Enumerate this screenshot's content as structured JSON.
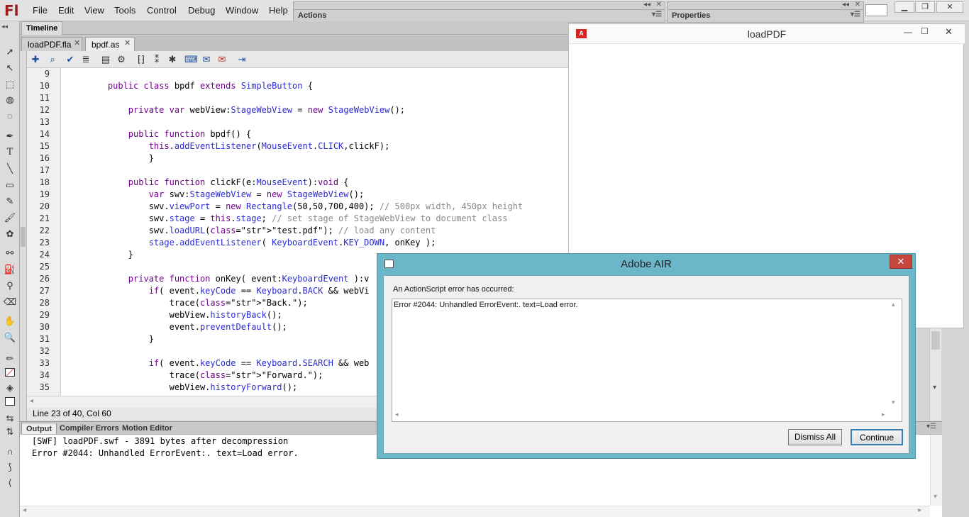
{
  "menubar": {
    "logo": "Fl",
    "items": [
      "File",
      "Edit",
      "View",
      "Tools",
      "Control",
      "Debug",
      "Window",
      "Help"
    ]
  },
  "panels": {
    "actions_label": "Actions",
    "properties_label": "Properties",
    "timeline_label": "Timeline"
  },
  "doc_tabs": [
    "loadPDF.fla",
    "bpdf.as"
  ],
  "code": {
    "lines": [
      {
        "n": "9",
        "text": ""
      },
      {
        "n": "10",
        "text": "    public class bpdf extends SimpleButton {"
      },
      {
        "n": "11",
        "text": ""
      },
      {
        "n": "12",
        "text": "        private var webView:StageWebView = new StageWebView();"
      },
      {
        "n": "13",
        "text": ""
      },
      {
        "n": "14",
        "text": "        public function bpdf() {"
      },
      {
        "n": "15",
        "text": "            this.addEventListener(MouseEvent.CLICK,clickF);"
      },
      {
        "n": "16",
        "text": "            }"
      },
      {
        "n": "17",
        "text": ""
      },
      {
        "n": "18",
        "text": "        public function clickF(e:MouseEvent):void {"
      },
      {
        "n": "19",
        "text": "            var swv:StageWebView = new StageWebView();"
      },
      {
        "n": "20",
        "text": "            swv.viewPort = new Rectangle(50,50,700,400); // 500px width, 450px height"
      },
      {
        "n": "21",
        "text": "            swv.stage = this.stage; // set stage of StageWebView to document class"
      },
      {
        "n": "22",
        "text": "            swv.loadURL(\"test.pdf\"); // load any content"
      },
      {
        "n": "23",
        "text": "            stage.addEventListener( KeyboardEvent.KEY_DOWN, onKey );"
      },
      {
        "n": "24",
        "text": "        }"
      },
      {
        "n": "25",
        "text": ""
      },
      {
        "n": "26",
        "text": "        private function onKey( event:KeyboardEvent ):v"
      },
      {
        "n": "27",
        "text": "            if( event.keyCode == Keyboard.BACK && webVi"
      },
      {
        "n": "28",
        "text": "                trace(\"Back.\");"
      },
      {
        "n": "29",
        "text": "                webView.historyBack();"
      },
      {
        "n": "30",
        "text": "                event.preventDefault();"
      },
      {
        "n": "31",
        "text": "            }"
      },
      {
        "n": "32",
        "text": ""
      },
      {
        "n": "33",
        "text": "            if( event.keyCode == Keyboard.SEARCH && web"
      },
      {
        "n": "34",
        "text": "                trace(\"Forward.\");"
      },
      {
        "n": "35",
        "text": "                webView.historyForward();"
      }
    ]
  },
  "status": {
    "position": "Line 23 of 40, Col 60"
  },
  "output_tabs": [
    "Output",
    "Compiler Errors",
    "Motion Editor"
  ],
  "output_lines": [
    "[SWF] loadPDF.swf - 3891 bytes after decompression",
    "Error #2044: Unhandled ErrorEvent:. text=Load error."
  ],
  "loadpdf_window": {
    "title": "loadPDF"
  },
  "air_dialog": {
    "title": "Adobe AIR",
    "message": "An ActionScript error has occurred:",
    "detail": "Error #2044: Unhandled ErrorEvent:. text=Load error.",
    "dismiss_label": "Dismiss All",
    "continue_label": "Continue",
    "close_glyph": "✕"
  },
  "colors": {
    "dialog_frame": "#6cb6c9",
    "close_red": "#c7463b",
    "logo_red": "#9b1c1c"
  }
}
